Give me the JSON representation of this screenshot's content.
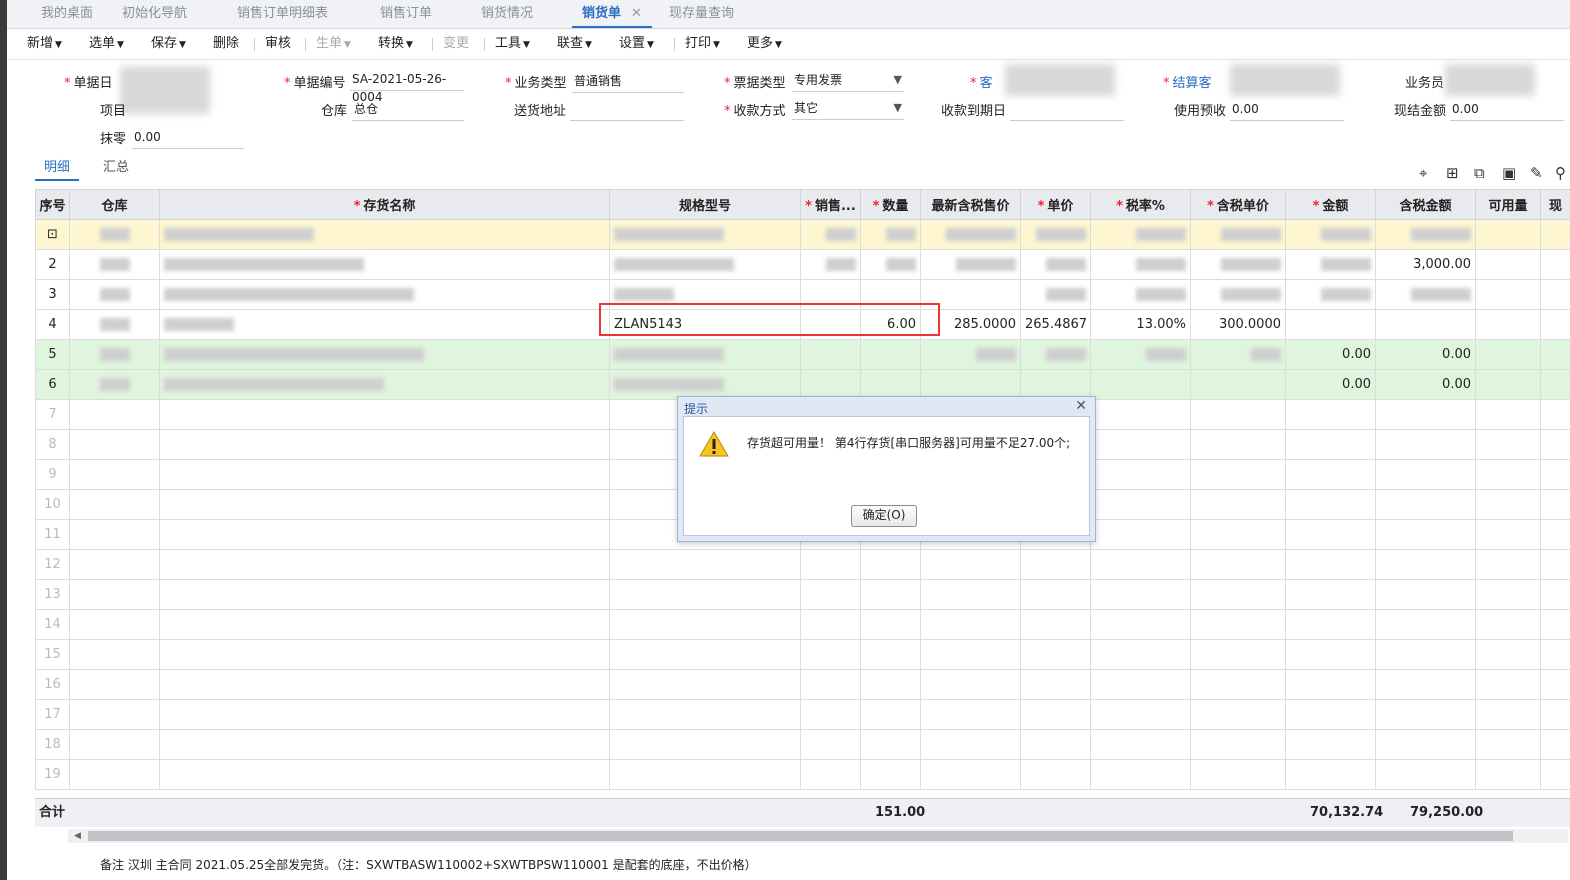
{
  "tabs": [
    {
      "label": "我的桌面",
      "active": false
    },
    {
      "label": "初始化导航",
      "active": false
    },
    {
      "label": "销售订单明细表",
      "active": false
    },
    {
      "label": "销售订单",
      "active": false
    },
    {
      "label": "销货情况",
      "active": false
    },
    {
      "label": "销货单",
      "active": true,
      "close": "✕"
    },
    {
      "label": "现存量查询",
      "active": false
    }
  ],
  "toolbar": {
    "new": "新增",
    "select": "选单",
    "save": "保存",
    "delete": "删除",
    "audit": "审核",
    "generate": "生单",
    "convert": "转换",
    "change": "变更",
    "tools": "工具",
    "query": "联查",
    "settings": "设置",
    "print": "打印",
    "more": "更多"
  },
  "form": {
    "doc_date_label": "单据日",
    "doc_no_label": "单据编号",
    "doc_no": "SA-2021-05-26-0004",
    "biz_type_label": "业务类型",
    "biz_type": "普通销售",
    "invoice_type_label": "票据类型",
    "invoice_type": "专用发票",
    "customer_label": "客",
    "settle_customer_label": "结算客",
    "salesman_label": "业务员",
    "project_label": "项目",
    "warehouse_label": "仓库",
    "warehouse": "总仓",
    "delivery_label": "送货地址",
    "delivery": "",
    "payment_label": "收款方式",
    "payment": "其它",
    "due_label": "收款到期日",
    "due": "",
    "prepay_label": "使用预收",
    "prepay": "0.00",
    "cash_label": "现结金额",
    "cash": "0.00",
    "rounding_label": "抹零",
    "rounding": "0.00"
  },
  "subtabs": {
    "detail": "明细",
    "summary": "汇总"
  },
  "grid": {
    "headers": [
      "序号",
      "仓库",
      "存货名称",
      "规格型号",
      "销售...",
      "数量",
      "最新含税售价",
      "单价",
      "税率%",
      "含税单价",
      "金额",
      "含税金额",
      "可用量",
      "现"
    ],
    "row2_total": "3,000.00",
    "row4": {
      "seq": "4",
      "spec": "ZLAN5143",
      "qty": "6.00",
      "latest_price": "285.0000",
      "unit_price": "265.4867",
      "tax_rate": "13.00%",
      "tax_price": "300.0000"
    },
    "row5": {
      "seq": "5",
      "amount": "0.00",
      "total": "0.00"
    },
    "row6": {
      "seq": "6",
      "amount": "0.00",
      "total": "0.00"
    },
    "rows_visible": [
      "2",
      "3",
      "7",
      "8",
      "9",
      "10",
      "11",
      "12",
      "13",
      "14",
      "15",
      "16",
      "17",
      "18",
      "19"
    ]
  },
  "totals": {
    "label": "合计",
    "qty": "151.00",
    "amount": "70,132.74",
    "total": "79,250.00"
  },
  "remark": "备注  汉圳 主合同 2021.05.25全部发完货。（注：SXWTBASW110002+SXWTBPSW110001  是配套的底座，不出价格）",
  "dialog": {
    "title": "提示",
    "message": "存货超可用量！  第4行存货[串口服务器]可用量不足27.00个;",
    "ok": "确定(O)"
  },
  "colors": {
    "accent": "#2b6fc2",
    "required": "#e23",
    "highlight": "#e33",
    "yellow_row": "#fdf6d0",
    "green_row": "#dff5dd"
  }
}
